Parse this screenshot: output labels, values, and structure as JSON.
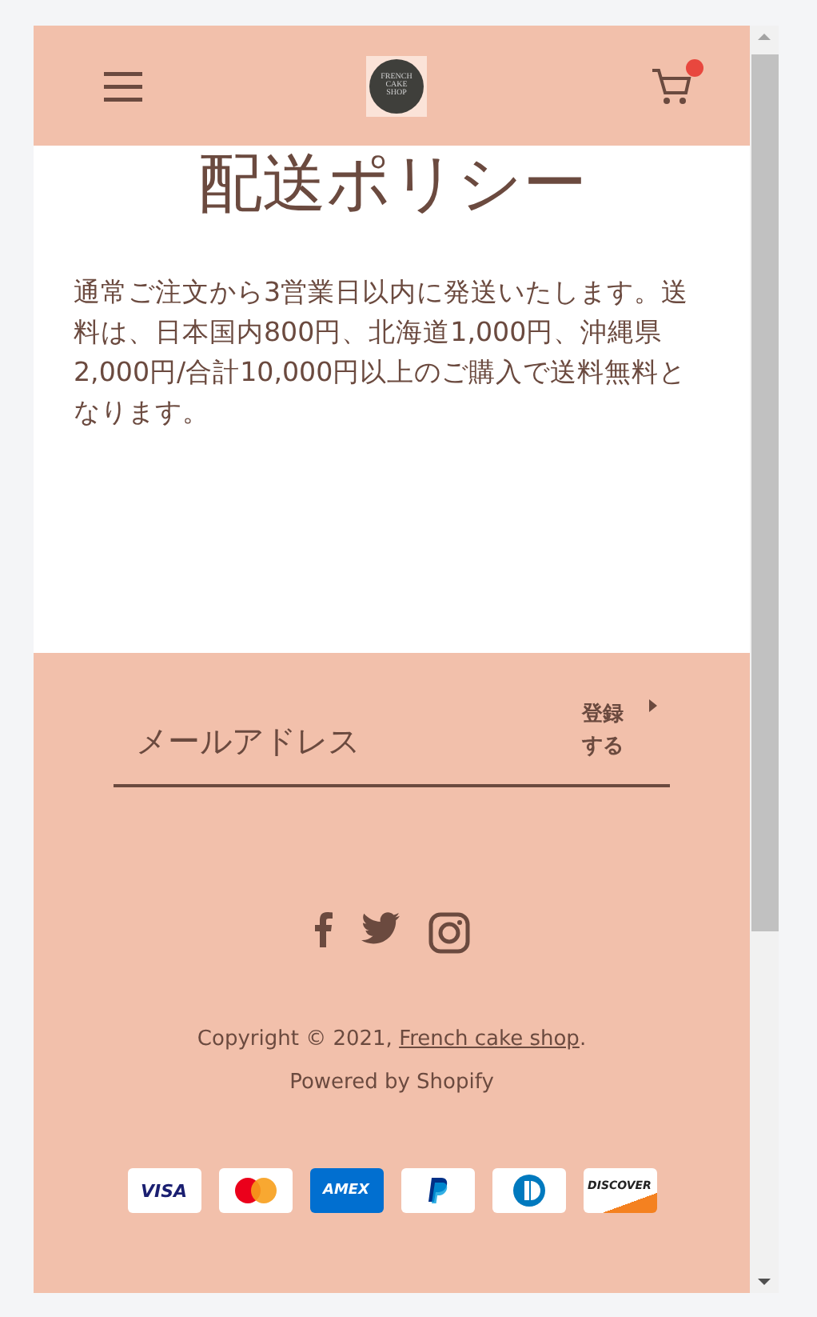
{
  "header": {
    "logo_text": "FRENCH CAKE SHOP",
    "cart": {
      "badge": true
    }
  },
  "page": {
    "title": "配送ポリシー",
    "body": "通常ご注文から3営業日以内に発送いたします。送料は、日本国内800円、北海道1,000円、沖縄県2,000円/合計10,000円以上のご購入で送料無料となります。"
  },
  "newsletter": {
    "placeholder": "メールアドレス",
    "button": "登録する"
  },
  "social": [
    {
      "kind": "facebook"
    },
    {
      "kind": "twitter"
    },
    {
      "kind": "instagram"
    }
  ],
  "copyright": {
    "prefix": "Copyright © 2021, ",
    "link": "French cake shop",
    "suffix": "."
  },
  "powered_by": "Powered by Shopify",
  "payments": [
    {
      "kind": "visa",
      "label": "VISA"
    },
    {
      "kind": "mastercard"
    },
    {
      "kind": "amex",
      "label": "AMEX"
    },
    {
      "kind": "paypal"
    },
    {
      "kind": "diners"
    },
    {
      "kind": "discover",
      "label": "DISCOVER"
    }
  ]
}
